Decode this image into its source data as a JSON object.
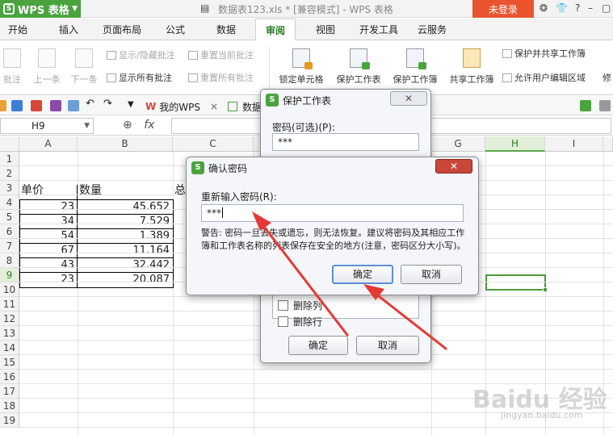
{
  "titlebar": {
    "app_name": "WPS 表格",
    "window_title": "数据表123.xls * [兼容模式] - WPS 表格",
    "login_label": "未登录"
  },
  "tabs": [
    "开始",
    "插入",
    "页面布局",
    "公式",
    "数据",
    "审阅",
    "视图",
    "开发工具",
    "云服务"
  ],
  "active_tab": "审阅",
  "ribbon": {
    "comment_partial": "批注",
    "prev": "上一条",
    "next": "下一条",
    "show_hide_comment": "显示/隐藏批注",
    "show_all_comments": "显示所有批注",
    "reset_current_comment": "重置当前批注",
    "reset_all_comments": "重置所有批注",
    "lock_cell": "锁定单元格",
    "protect_sheet": "保护工作表",
    "protect_workbook": "保护工作簿",
    "share_workbook": "共享工作簿",
    "protect_and_share": "保护并共享工作簿",
    "allow_edit_ranges": "允许用户编辑区域",
    "modify_partial": "修"
  },
  "doc_tabs": {
    "my_wps": "我的WPS",
    "data_partial": "数据"
  },
  "formula_bar": {
    "name_box": "H9",
    "fx_label": "fx"
  },
  "grid": {
    "columns": [
      "A",
      "B",
      "C",
      "G",
      "H",
      "I"
    ],
    "rows": [
      "1",
      "2",
      "3",
      "4",
      "5",
      "6",
      "7",
      "8",
      "9",
      "10",
      "11",
      "12",
      "13",
      "14",
      "15",
      "16",
      "17",
      "18",
      "19"
    ],
    "header_row": {
      "a": "单价",
      "b": "数量",
      "c_partial": "总"
    },
    "data": [
      {
        "a": "23",
        "b": "45.652"
      },
      {
        "a": "34",
        "b": "7.529"
      },
      {
        "a": "54",
        "b": "1.389"
      },
      {
        "a": "67",
        "b": "11.164"
      },
      {
        "a": "43",
        "b": "32.442"
      },
      {
        "a": "23",
        "b": "20.087"
      }
    ]
  },
  "protect_dialog": {
    "title": "保护工作表",
    "password_label": "密码(可选)(P):",
    "password_value": "***",
    "options": [
      "删除列",
      "删除行"
    ],
    "ok": "确定",
    "cancel": "取消"
  },
  "confirm_dialog": {
    "title": "确认密码",
    "reenter_label": "重新输入密码(R):",
    "password_value": "***",
    "warning": "警告: 密码一旦丢失或遗忘，则无法恢复。建议将密码及其相应工作簿和工作表名称的列表保存在安全的地方(注意，密码区分大小写)。",
    "ok": "确定",
    "cancel": "取消"
  },
  "watermark": {
    "main": "Baidu 经验",
    "sub": "jingyan.baidu.com"
  },
  "colors": {
    "brand_green": "#4aa33f",
    "login_orange": "#e9542e",
    "close_red": "#c9463a",
    "arrow_red": "#e53935",
    "selection_green": "#4a9c3a"
  }
}
